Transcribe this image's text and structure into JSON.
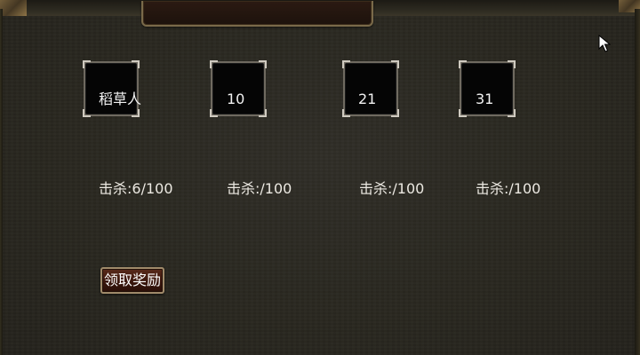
{
  "slots": [
    {
      "label": "稻草人"
    },
    {
      "label": "10"
    },
    {
      "label": "21"
    },
    {
      "label": "31"
    }
  ],
  "kills": [
    {
      "text": "击杀:6/100"
    },
    {
      "text": "击杀:/100"
    },
    {
      "text": "击杀:/100"
    },
    {
      "text": "击杀:/100"
    }
  ],
  "reward_button": {
    "label": "领取奖励"
  },
  "colors": {
    "background": "#2a2822",
    "slot_fill": "#050505",
    "button_fill": "#3a160d",
    "text": "#f2f2f2"
  }
}
